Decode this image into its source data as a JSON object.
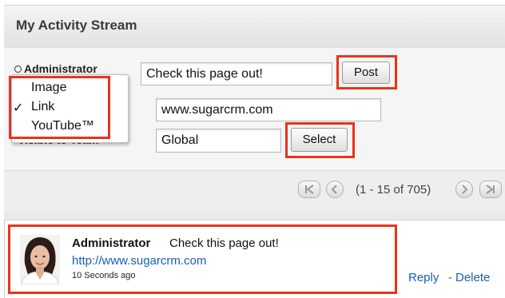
{
  "header": {
    "title": "My Activity Stream"
  },
  "post_form": {
    "user_label": "Administrator",
    "message_value": "Check this page out!",
    "post_label": "Post",
    "url_value": "www.sugarcrm.com",
    "visibility_label": "Visible to Team",
    "team_value": "Global",
    "select_label": "Select",
    "attach_menu": {
      "items": [
        {
          "label": "Image",
          "checked": false
        },
        {
          "label": "Link",
          "checked": true
        },
        {
          "label": "YouTube™",
          "checked": false
        }
      ],
      "check_glyph": "✓"
    }
  },
  "pager": {
    "range_text": "(1 - 15 of 705)"
  },
  "activity": {
    "author": "Administrator",
    "message": "Check this page out!",
    "link": "http://www.sugarcrm.com",
    "time": "10 Seconds ago",
    "reply_label": "Reply",
    "separator": "-",
    "delete_label": "Delete"
  },
  "colors": {
    "highlight": "#e8341c",
    "link": "#1a5fb4"
  }
}
